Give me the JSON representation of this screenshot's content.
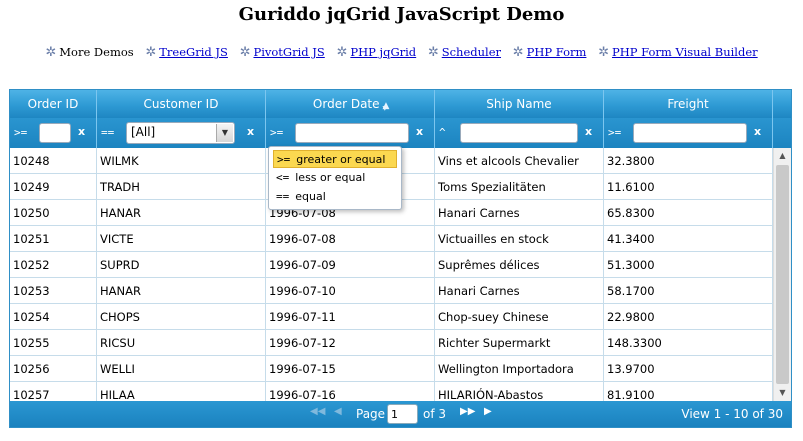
{
  "page": {
    "title": "Guriddo jqGrid JavaScript Demo",
    "links": [
      {
        "label": "More Demos",
        "link": false
      },
      {
        "label": "TreeGrid JS",
        "link": true
      },
      {
        "label": "PivotGrid JS",
        "link": true
      },
      {
        "label": "PHP jqGrid",
        "link": true
      },
      {
        "label": "Scheduler",
        "link": true
      },
      {
        "label": "PHP Form",
        "link": true
      },
      {
        "label": "PHP Form Visual Builder",
        "link": true
      }
    ]
  },
  "grid": {
    "columns": [
      "Order ID",
      "Customer ID",
      "Order Date",
      "Ship Name",
      "Freight"
    ],
    "sort_icon": "sort-up-down-icon",
    "filters": {
      "order_id": {
        "op": ">=",
        "value": ""
      },
      "customer_id": {
        "op": "==",
        "value": "[All]"
      },
      "order_date": {
        "op": ">=",
        "value": ""
      },
      "ship_name": {
        "op": "^",
        "value": ""
      },
      "freight": {
        "op": ">=",
        "value": ""
      },
      "clear": "x"
    },
    "rows": [
      [
        "10248",
        "WILMK",
        "",
        "Vins et alcools Chevalier",
        "32.3800"
      ],
      [
        "10249",
        "TRADH",
        "",
        "Toms Spezialitäten",
        "11.6100"
      ],
      [
        "10250",
        "HANAR",
        "1996-07-08",
        "Hanari Carnes",
        "65.8300"
      ],
      [
        "10251",
        "VICTE",
        "1996-07-08",
        "Victuailles en stock",
        "41.3400"
      ],
      [
        "10252",
        "SUPRD",
        "1996-07-09",
        "Suprêmes délices",
        "51.3000"
      ],
      [
        "10253",
        "HANAR",
        "1996-07-10",
        "Hanari Carnes",
        "58.1700"
      ],
      [
        "10254",
        "CHOPS",
        "1996-07-11",
        "Chop-suey Chinese",
        "22.9800"
      ],
      [
        "10255",
        "RICSU",
        "1996-07-12",
        "Richter Supermarkt",
        "148.3300"
      ],
      [
        "10256",
        "WELLI",
        "1996-07-15",
        "Wellington Importadora",
        "13.9700"
      ],
      [
        "10257",
        "HILAA",
        "1996-07-16",
        "HILARIÓN-Abastos",
        "81.9100"
      ]
    ],
    "pager": {
      "first": "◀◀",
      "prev": "◀",
      "page_label": "Page",
      "page_value": "1",
      "of_label": "of 3",
      "next": "▶▶",
      "last": "▶",
      "view": "View 1 - 10 of 30"
    }
  },
  "popup": {
    "options": [
      {
        "op": ">=",
        "label": "greater or equal"
      },
      {
        "op": "<=",
        "label": "less or equal"
      },
      {
        "op": "==",
        "label": "equal"
      }
    ]
  },
  "colors": {
    "header": "#2e9ad4",
    "highlight": "#fbd850",
    "link": "#0000cc"
  }
}
